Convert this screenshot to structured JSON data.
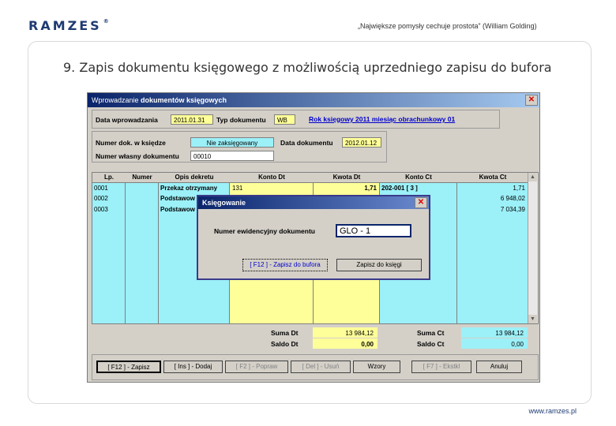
{
  "slide": {
    "logo": "RAMZES",
    "logo_mark": "®",
    "quote": "„Największe pomysły cechuje prostota” (William Golding)",
    "title": "9. Zapis dokumentu księgowego z możliwością uprzedniego zapisu do bufora",
    "footer": "www.ramzes.pl"
  },
  "window": {
    "title_prefix": "Wprowadzanie ",
    "title_bold": "dokumentów księgowych",
    "close_icon": "close-icon"
  },
  "header": {
    "date_entered_label": "Data wprowadzania",
    "date_entered": "2011.01.31",
    "doc_type_label": "Typ dokumentu",
    "doc_type": "WB",
    "period_link": "Rok księgowy 2011 miesiąc obrachunkowy 01",
    "doc_number_label": "Numer dok. w księdze",
    "doc_number": "Nie zaksięgowany",
    "doc_date_label": "Data dokumentu",
    "doc_date": "2012.01.12",
    "own_number_label": "Numer własny dokumentu",
    "own_number": "00010"
  },
  "grid": {
    "columns": [
      "Lp.",
      "Numer",
      "Opis dekretu",
      "Konto Dt",
      "Kwota Dt",
      "Konto Ct",
      "Kwota Ct"
    ],
    "rows": [
      {
        "lp": "0001",
        "numer": "",
        "opis": "Przekaz otrzymany",
        "konto_dt": "131",
        "kwota_dt": "1,71",
        "konto_ct": "202-001 [ 3 ]",
        "kwota_ct": "1,71"
      },
      {
        "lp": "0002",
        "numer": "",
        "opis": "Podstawow",
        "konto_dt": "",
        "kwota_dt": "",
        "konto_ct": "",
        "kwota_ct": "6 948,02"
      },
      {
        "lp": "0003",
        "numer": "",
        "opis": "Podstawow",
        "konto_dt": "",
        "kwota_dt": "",
        "konto_ct": "",
        "kwota_ct": "7 034,39"
      }
    ]
  },
  "totals": {
    "suma_dt_label": "Suma Dt",
    "suma_dt": "13 984,12",
    "saldo_dt_label": "Saldo Dt",
    "saldo_dt": "0,00",
    "suma_ct_label": "Suma Ct",
    "suma_ct": "13 984,12",
    "saldo_ct_label": "Saldo Ct",
    "saldo_ct": "0,00"
  },
  "buttons": {
    "save": "[ F12 ] - Zapisz",
    "add": "[ Ins ] - Dodaj",
    "edit": "[ F2 ] - Popraw",
    "delete": "[ Del ] - Usuń",
    "templates": "Wzory",
    "f7": "[ F7 ] - Ekstkl",
    "cancel": "Anuluj"
  },
  "dialog": {
    "title": "Księgowanie",
    "field_label": "Numer ewidencyjny dokumentu",
    "field_value": "GLO - 1",
    "buffer_button": "[ F12 ] - Zapisz do bufora",
    "post_button": "Zapisz do księgi"
  },
  "colors": {
    "cyan": "#9cf0f8",
    "yellow": "#ffff99",
    "window_bg": "#d4d0c8",
    "title_blue": "#0a246a"
  }
}
